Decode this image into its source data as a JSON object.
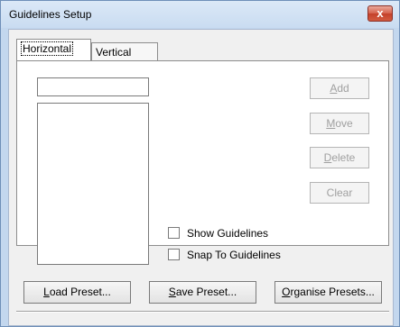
{
  "window": {
    "title": "Guidelines Setup",
    "close_glyph": "x"
  },
  "tabs": [
    {
      "label": "Horizontal",
      "active": true
    },
    {
      "label": "Vertical",
      "active": false
    }
  ],
  "value_input": {
    "value": ""
  },
  "side_buttons": {
    "add": {
      "pre": "",
      "mn": "A",
      "post": "dd"
    },
    "move": {
      "pre": "",
      "mn": "M",
      "post": "ove"
    },
    "delete": {
      "pre": "",
      "mn": "D",
      "post": "elete"
    },
    "clear": {
      "label": "Clear"
    }
  },
  "checkboxes": {
    "show_guidelines": {
      "label": "Show Guidelines",
      "checked": false
    },
    "snap_to_guidelines": {
      "label": "Snap To Guidelines",
      "checked": false
    }
  },
  "bottom_buttons": {
    "load_preset": {
      "pre": "",
      "mn": "L",
      "post": "oad Preset..."
    },
    "save_preset": {
      "pre": "",
      "mn": "S",
      "post": "ave Preset..."
    },
    "organise_presets": {
      "pre": "",
      "mn": "O",
      "post": "rganise Presets..."
    }
  },
  "colors": {
    "close_button": "#c4412b",
    "title_bar": "#c9dcf1",
    "disabled_text": "#a0a0a0"
  }
}
